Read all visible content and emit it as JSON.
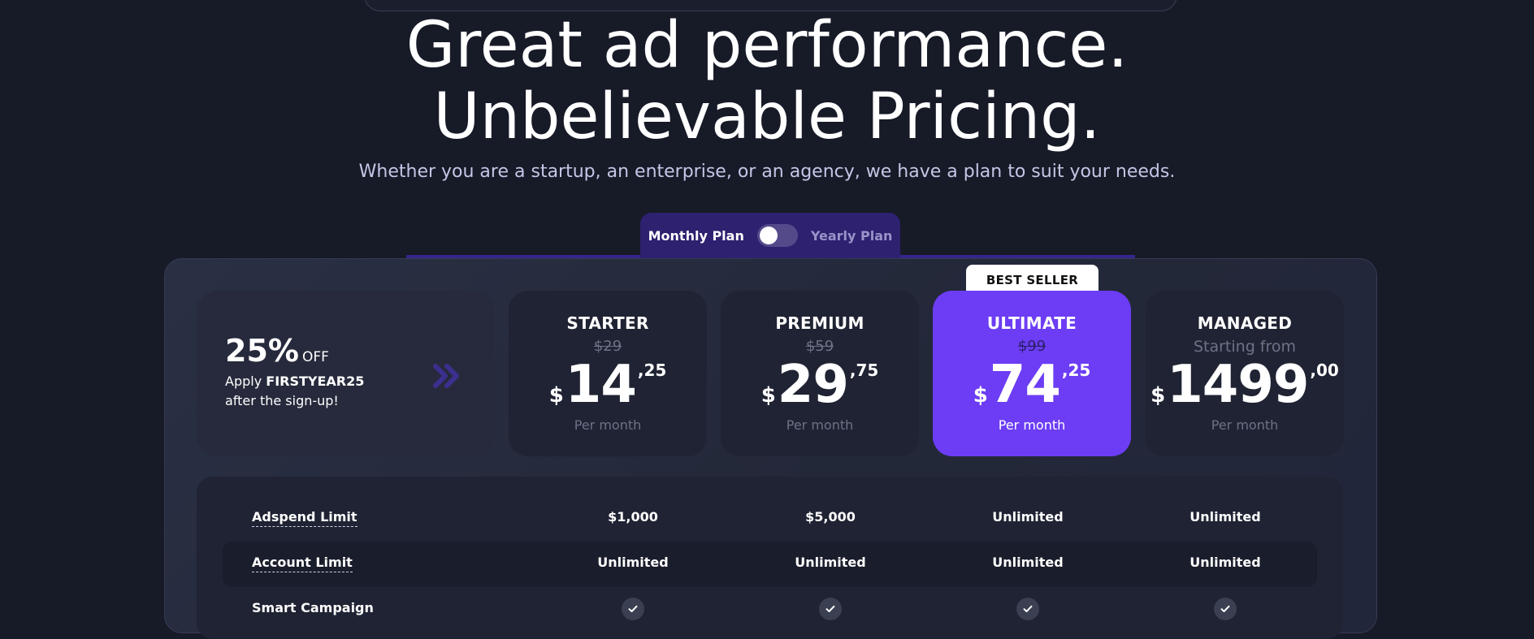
{
  "hero": {
    "title_line1": "Great ad performance.",
    "title_line2": "Unbelievable Pricing.",
    "subtitle": "Whether you are a startup, an enterprise, or an agency, we have a plan to suit your needs."
  },
  "billing_toggle": {
    "monthly_label": "Monthly Plan",
    "yearly_label": "Yearly Plan",
    "selected": "Monthly Plan"
  },
  "promo": {
    "percent": "25%",
    "off_label": "OFF",
    "apply_prefix": "Apply",
    "code": "FIRSTYEAR25",
    "after_text": "after the sign-up!",
    "icon": "double-chevron-right-icon"
  },
  "best_seller_badge": "BEST SELLER",
  "plans": [
    {
      "name": "STARTER",
      "old_price": "$29",
      "currency": "$",
      "amount": "14",
      "cents": ",25",
      "period": "Per month"
    },
    {
      "name": "PREMIUM",
      "old_price": "$59",
      "currency": "$",
      "amount": "29",
      "cents": ",75",
      "period": "Per month"
    },
    {
      "name": "ULTIMATE",
      "old_price": "$99",
      "currency": "$",
      "amount": "74",
      "cents": ",25",
      "period": "Per month"
    },
    {
      "name": "MANAGED",
      "starting_from": "Starting from",
      "currency": "$",
      "amount": "1499",
      "cents": ",00",
      "period": "Per month"
    }
  ],
  "features": [
    {
      "label": "Adspend Limit",
      "values": [
        "$1,000",
        "$5,000",
        "Unlimited",
        "Unlimited"
      ]
    },
    {
      "label": "Account Limit",
      "values": [
        "Unlimited",
        "Unlimited",
        "Unlimited",
        "Unlimited"
      ]
    },
    {
      "label": "Smart Campaign",
      "check_icons": [
        "check-icon",
        "check-icon",
        "check-icon",
        "check-icon"
      ]
    }
  ],
  "colors": {
    "background": "#171a27",
    "accent_purple": "#6c3df4",
    "toggle_tab": "#2d2170",
    "muted_text": "#6d7288"
  }
}
